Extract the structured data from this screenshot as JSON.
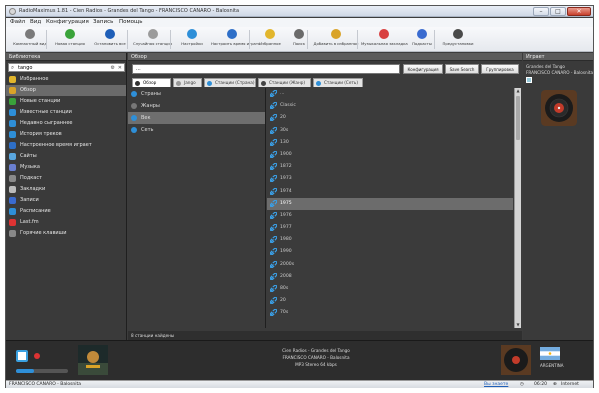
{
  "window": {
    "title": "RadioMaximus 1.81 - Cien Radios - Grandes del Tango - FRANCISCO CANARO - Balosnita"
  },
  "menu": [
    "Файл",
    "Вид",
    "Конфигурация",
    "Запись",
    "Помощь"
  ],
  "toolbar": [
    {
      "label": "Компактный вид",
      "icon": "compact-view-icon",
      "color": "#7a7a7a"
    },
    {
      "label": "Новая станция",
      "icon": "add-station-icon",
      "color": "#3aa33a"
    },
    {
      "label": "Остановить все",
      "icon": "stop-all-icon",
      "color": "#1f5fb8"
    },
    {
      "label": "Случайная станция",
      "icon": "random-station-icon",
      "color": "#9b9b9b"
    },
    {
      "label": "Настройки",
      "icon": "settings-icon",
      "color": "#2e8fd8"
    },
    {
      "label": "Настроить время играть",
      "icon": "timer-icon",
      "color": "#2e6fc8"
    },
    {
      "label": "Избранное",
      "icon": "favorites-icon",
      "color": "#e2b62c"
    },
    {
      "label": "Поиск",
      "icon": "search-icon",
      "color": "#6a6a6a"
    },
    {
      "label": "Добавить в избранное",
      "icon": "add-favorite-icon",
      "color": "#d9a328"
    },
    {
      "label": "Музыкальная закладка",
      "icon": "music-bookmark-icon",
      "color": "#d84040"
    },
    {
      "label": "Подкасты",
      "icon": "podcast-icon",
      "color": "#3a6bd0"
    },
    {
      "label": "Предустановки",
      "icon": "presets-icon",
      "color": "#4a4a4a"
    }
  ],
  "library": {
    "header": "Библиотека",
    "search_value": "tango",
    "items": [
      {
        "label": "Избранное",
        "icon": "star-icon",
        "color": "#e2b62c"
      },
      {
        "label": "Обзор",
        "icon": "browse-icon",
        "color": "#d9a328",
        "selected": true
      },
      {
        "label": "Новые станции",
        "icon": "new-stations-icon",
        "color": "#3aa33a"
      },
      {
        "label": "Известные станции",
        "icon": "known-stations-icon",
        "color": "#2e8fd8"
      },
      {
        "label": "Недавно сыграннее",
        "icon": "recent-icon",
        "color": "#2e8fd8"
      },
      {
        "label": "История треков",
        "icon": "track-history-icon",
        "color": "#2e8fd8"
      },
      {
        "label": "Настроенное время играет",
        "icon": "scheduled-icon",
        "color": "#2e6fc8"
      },
      {
        "label": "Сайты",
        "icon": "sites-icon",
        "color": "#5aa7e0"
      },
      {
        "label": "Музыка",
        "icon": "music-icon",
        "color": "#6a7fd0"
      },
      {
        "label": "Подкаст",
        "icon": "podcast-icon",
        "color": "#8a8a8a"
      },
      {
        "label": "Закладки",
        "icon": "bookmarks-icon",
        "color": "#bbb"
      },
      {
        "label": "Записи",
        "icon": "recordings-icon",
        "color": "#3a6bd0"
      },
      {
        "label": "Расписание",
        "icon": "schedule-icon",
        "color": "#2e8fd8"
      },
      {
        "label": "Last.fm",
        "icon": "lastfm-icon",
        "color": "#d33"
      },
      {
        "label": "Горячие клавиши",
        "icon": "hotkeys-icon",
        "color": "#888"
      }
    ]
  },
  "browse": {
    "header": "Обзор",
    "address_value": "...",
    "buttons": [
      "Конфигурация",
      "Save Search",
      "Группировка"
    ],
    "tabs": [
      {
        "label": "Обзор",
        "icon": "browse-tab-icon",
        "color": "#333",
        "active": true
      },
      {
        "label": "Jango",
        "icon": "jango-icon",
        "color": "#999"
      },
      {
        "label": "Станции (Страна)",
        "icon": "globe-icon",
        "color": "#2e8fd8"
      },
      {
        "label": "Станции (Жанр)",
        "icon": "genre-icon",
        "color": "#444"
      },
      {
        "label": "Станции (Сеть)",
        "icon": "network-icon",
        "color": "#2e8fd8"
      }
    ],
    "categories": [
      {
        "label": "Страны",
        "icon": "countries-icon",
        "color": "#2e8fd8"
      },
      {
        "label": "Жанры",
        "icon": "genres-icon",
        "color": "#777"
      },
      {
        "label": "Век",
        "icon": "century-icon",
        "color": "#2e8fd8",
        "selected": true
      },
      {
        "label": "Сеть",
        "icon": "net-icon",
        "color": "#2e8fd8"
      }
    ],
    "years": [
      {
        "label": "..."
      },
      {
        "label": "Classic"
      },
      {
        "label": "20"
      },
      {
        "label": "30s"
      },
      {
        "label": "130"
      },
      {
        "label": "1900"
      },
      {
        "label": "1872"
      },
      {
        "label": "1973"
      },
      {
        "label": "1974"
      },
      {
        "label": "1975",
        "selected": true
      },
      {
        "label": "1976"
      },
      {
        "label": "1977"
      },
      {
        "label": "1980"
      },
      {
        "label": "1990"
      },
      {
        "label": "2000s"
      },
      {
        "label": "2008"
      },
      {
        "label": "80s"
      },
      {
        "label": "20"
      },
      {
        "label": "70s"
      }
    ],
    "status": "8 станции найдены"
  },
  "player_panel": {
    "header": "Играет",
    "line1": "Grandes del Tango",
    "line2": "FRANCISCO CANARO - Balosnita"
  },
  "player": {
    "station": "Cien Radios - Grandes del Tango",
    "track": "FRANCISCO CANARO - Balosnita",
    "format": "MP3 Stereo 64 kbps",
    "country": "ARGENTINA"
  },
  "statusbar": {
    "left": "FRANCISCO CANARO - Balosnita",
    "link": "Вы знаете",
    "time": "06:20",
    "network": "Internet"
  }
}
